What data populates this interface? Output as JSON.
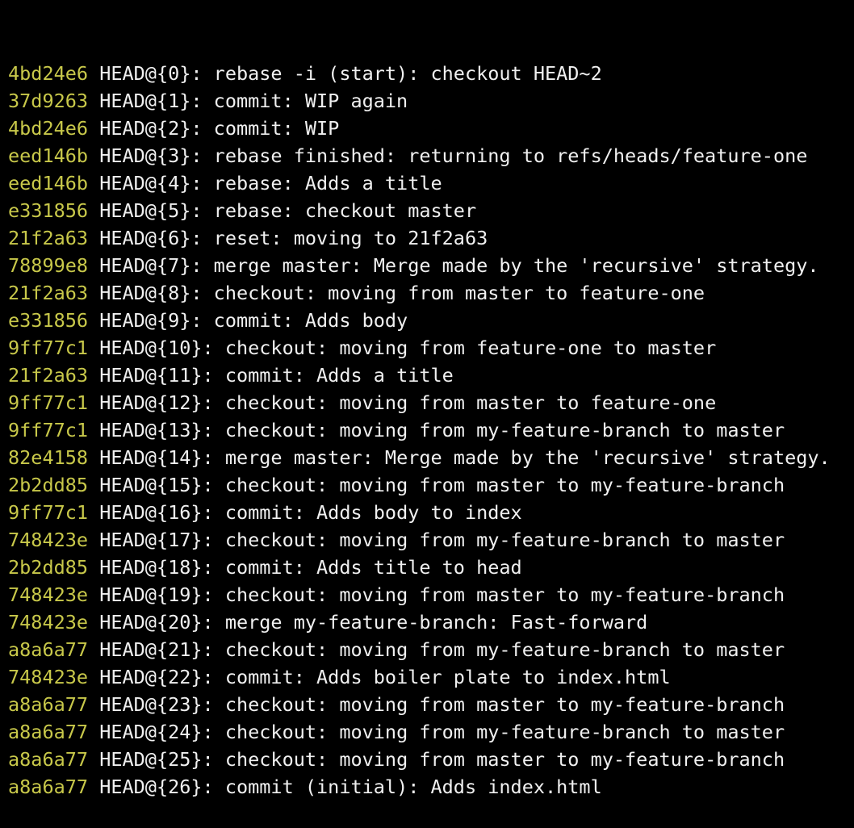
{
  "colors": {
    "background": "#000000",
    "hash": "#c8c84a",
    "text": "#f0f0f0"
  },
  "reflog": [
    {
      "hash": "4bd24e6",
      "ref": "HEAD@{0}",
      "message": ": rebase -i (start): checkout HEAD~2"
    },
    {
      "hash": "37d9263",
      "ref": "HEAD@{1}",
      "message": ": commit: WIP again"
    },
    {
      "hash": "4bd24e6",
      "ref": "HEAD@{2}",
      "message": ": commit: WIP"
    },
    {
      "hash": "eed146b",
      "ref": "HEAD@{3}",
      "message": ": rebase finished: returning to refs/heads/feature-one"
    },
    {
      "hash": "eed146b",
      "ref": "HEAD@{4}",
      "message": ": rebase: Adds a title"
    },
    {
      "hash": "e331856",
      "ref": "HEAD@{5}",
      "message": ": rebase: checkout master"
    },
    {
      "hash": "21f2a63",
      "ref": "HEAD@{6}",
      "message": ": reset: moving to 21f2a63"
    },
    {
      "hash": "78899e8",
      "ref": "HEAD@{7}",
      "message": ": merge master: Merge made by the 'recursive' strategy."
    },
    {
      "hash": "21f2a63",
      "ref": "HEAD@{8}",
      "message": ": checkout: moving from master to feature-one"
    },
    {
      "hash": "e331856",
      "ref": "HEAD@{9}",
      "message": ": commit: Adds body"
    },
    {
      "hash": "9ff77c1",
      "ref": "HEAD@{10}",
      "message": ": checkout: moving from feature-one to master"
    },
    {
      "hash": "21f2a63",
      "ref": "HEAD@{11}",
      "message": ": commit: Adds a title"
    },
    {
      "hash": "9ff77c1",
      "ref": "HEAD@{12}",
      "message": ": checkout: moving from master to feature-one"
    },
    {
      "hash": "9ff77c1",
      "ref": "HEAD@{13}",
      "message": ": checkout: moving from my-feature-branch to master"
    },
    {
      "hash": "82e4158",
      "ref": "HEAD@{14}",
      "message": ": merge master: Merge made by the 'recursive' strategy."
    },
    {
      "hash": "2b2dd85",
      "ref": "HEAD@{15}",
      "message": ": checkout: moving from master to my-feature-branch"
    },
    {
      "hash": "9ff77c1",
      "ref": "HEAD@{16}",
      "message": ": commit: Adds body to index"
    },
    {
      "hash": "748423e",
      "ref": "HEAD@{17}",
      "message": ": checkout: moving from my-feature-branch to master"
    },
    {
      "hash": "2b2dd85",
      "ref": "HEAD@{18}",
      "message": ": commit: Adds title to head"
    },
    {
      "hash": "748423e",
      "ref": "HEAD@{19}",
      "message": ": checkout: moving from master to my-feature-branch"
    },
    {
      "hash": "748423e",
      "ref": "HEAD@{20}",
      "message": ": merge my-feature-branch: Fast-forward"
    },
    {
      "hash": "a8a6a77",
      "ref": "HEAD@{21}",
      "message": ": checkout: moving from my-feature-branch to master"
    },
    {
      "hash": "748423e",
      "ref": "HEAD@{22}",
      "message": ": commit: Adds boiler plate to index.html"
    },
    {
      "hash": "a8a6a77",
      "ref": "HEAD@{23}",
      "message": ": checkout: moving from master to my-feature-branch"
    },
    {
      "hash": "a8a6a77",
      "ref": "HEAD@{24}",
      "message": ": checkout: moving from my-feature-branch to master"
    },
    {
      "hash": "a8a6a77",
      "ref": "HEAD@{25}",
      "message": ": checkout: moving from master to my-feature-branch"
    },
    {
      "hash": "a8a6a77",
      "ref": "HEAD@{26}",
      "message": ": commit (initial): Adds index.html"
    }
  ]
}
